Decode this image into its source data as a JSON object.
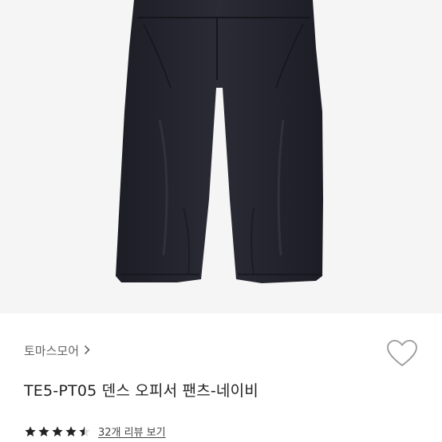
{
  "product": {
    "brand": "토마스모어",
    "title": "TE5-PT05 덴스 오피서 팬츠-네이비",
    "rating": 4.5,
    "review_link": "32개 리뷰 보기"
  },
  "icons": {
    "brand_chevron": "chevron-right-icon",
    "wishlist": "heart-outline-icon",
    "star": "star-icon"
  },
  "colors": {
    "image_bg": "#f5f5f5",
    "pants": "#22232c",
    "star": "#222222",
    "heart_stroke": "#9a9a9a"
  }
}
